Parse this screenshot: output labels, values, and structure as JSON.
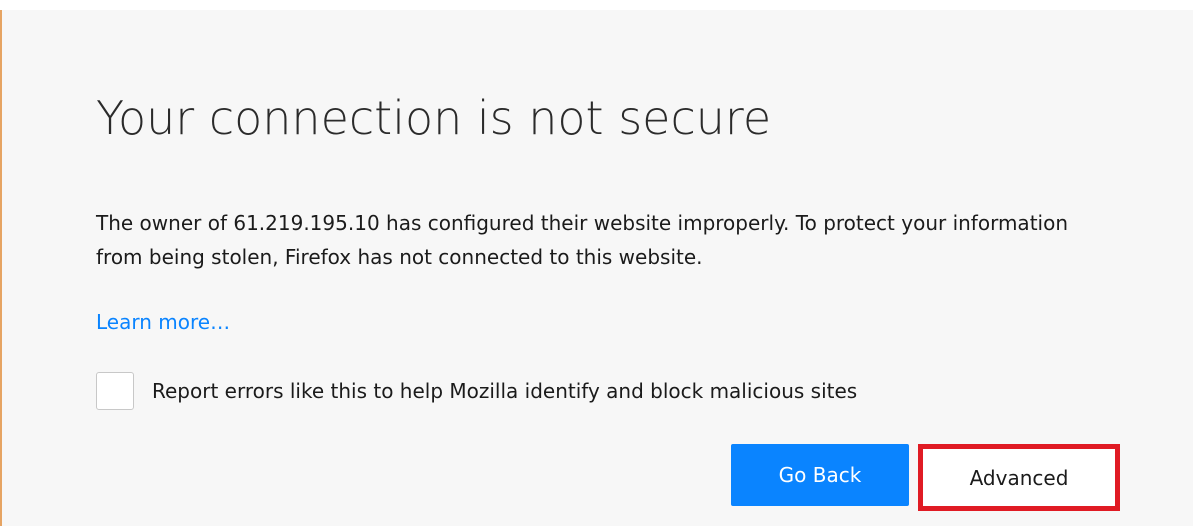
{
  "error_page": {
    "title": "Your connection is not secure",
    "description": "The owner of 61.219.195.10 has configured their website improperly. To protect your information from being stolen, Firefox has not connected to this website.",
    "learn_more": "Learn more…",
    "report_checkbox": {
      "label": "Report errors like this to help Mozilla identify and block malicious sites",
      "checked": false
    },
    "buttons": {
      "go_back": "Go Back",
      "advanced": "Advanced"
    }
  },
  "colors": {
    "accent": "#0a84ff",
    "highlight_box": "#e01b24",
    "page_background": "#f7f7f7",
    "left_border": "#e6a463"
  }
}
